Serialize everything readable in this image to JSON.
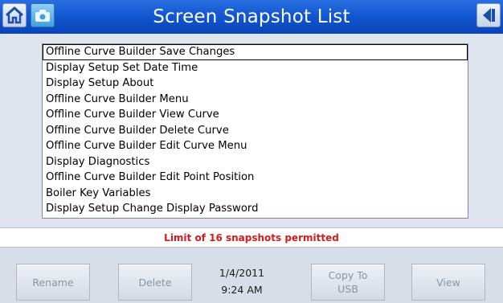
{
  "header": {
    "title": "Screen Snapshot List"
  },
  "snapshots": [
    "Offline Curve Builder Save Changes",
    "Display Setup Set Date Time",
    "Display Setup About",
    "Offline Curve Builder Menu",
    "Offline Curve Builder View Curve",
    "Offline Curve Builder Delete Curve",
    "Offline Curve Builder Edit Curve Menu",
    "Display Diagnostics",
    "Offline Curve Builder Edit Point Position",
    "Boiler Key Variables",
    "Display Setup Change Display Password"
  ],
  "status": {
    "message": "Limit of 16 snapshots permitted"
  },
  "datetime": {
    "date": "1/4/2011",
    "time": "9:24 AM"
  },
  "buttons": {
    "rename": "Rename",
    "delete": "Delete",
    "copy_to_usb_1": "Copy To",
    "copy_to_usb_2": "USB",
    "view": "View"
  },
  "colors": {
    "titlebar": "#1257d2",
    "status_text": "#d21c1c"
  },
  "icons": [
    "home-icon",
    "camera-icon",
    "back-arrow-icon"
  ]
}
